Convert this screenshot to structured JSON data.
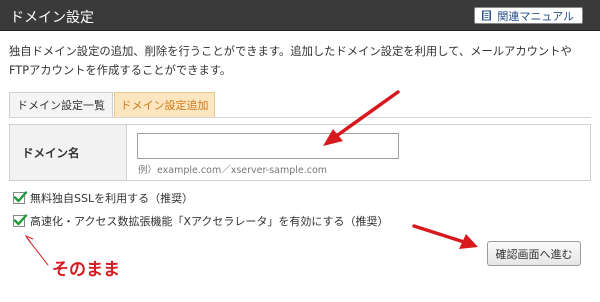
{
  "header": {
    "title": "ドメイン設定",
    "manual_button": "関連マニュアル",
    "manual_icon": "book-icon"
  },
  "description": "独自ドメイン設定の追加、削除を行うことができます。追加したドメイン設定を利用して、メールアカウントやFTPアカウントを作成することができます。",
  "tabs": [
    {
      "label": "ドメイン設定一覧",
      "active": false
    },
    {
      "label": "ドメイン設定追加",
      "active": true
    }
  ],
  "form": {
    "domain_label": "ドメイン名",
    "domain_value": "",
    "example": "例）example.com／xserver-sample.com"
  },
  "options": [
    {
      "label": "無料独自SSLを利用する（推奨）",
      "checked": true
    },
    {
      "label": "高速化・アクセス数拡張機能「Xアクセラレータ」を有効にする（推奨）",
      "checked": true
    }
  ],
  "confirm_button": "確認画面へ進む",
  "annotation": "そのまま",
  "colors": {
    "header_bg": "#3a3a3a",
    "active_tab_bg": "#fbe6bf",
    "active_tab_text": "#d07a1a",
    "check_green": "#1f9a3a",
    "annotation_red": "#d7191e"
  }
}
